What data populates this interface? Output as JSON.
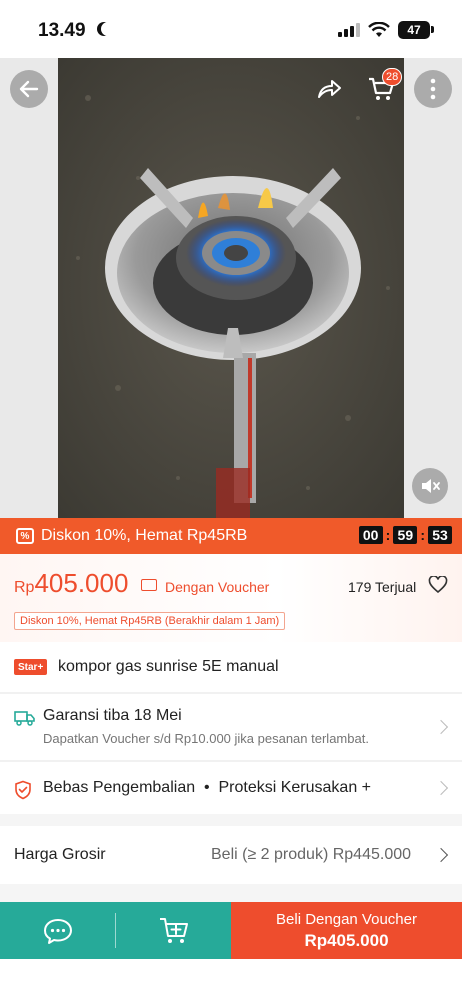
{
  "status_bar": {
    "time": "13.49",
    "battery": "47"
  },
  "header": {
    "cart_count": "28"
  },
  "flash_sale": {
    "text": "Diskon 10%, Hemat Rp45RB",
    "countdown": [
      "00",
      "59",
      "53"
    ]
  },
  "price": {
    "currency": "Rp",
    "amount": "405.000",
    "voucher_label": "Dengan Voucher",
    "sold": "179 Terjual",
    "discount_tag": "Diskon 10%, Hemat Rp45RB (Berakhir dalam 1 Jam)"
  },
  "product": {
    "badge": "Star+",
    "title": "kompor gas sunrise 5E manual"
  },
  "shipping": {
    "title": "Garansi tiba 18 Mei",
    "subtitle": "Dapatkan Voucher s/d Rp10.000 jika pesanan terlambat."
  },
  "returns": {
    "text": "Bebas Pengembalian  •  Proteksi Kerusakan +"
  },
  "wholesale": {
    "label": "Harga Grosir",
    "value": "Beli (≥ 2 produk) Rp445.000"
  },
  "bottom_bar": {
    "buy_label": "Beli Dengan Voucher",
    "buy_price": "Rp405.000"
  },
  "colors": {
    "brand": "#ee4d2d",
    "teal": "#26aa99",
    "flash_bg": "#f05a2a"
  }
}
